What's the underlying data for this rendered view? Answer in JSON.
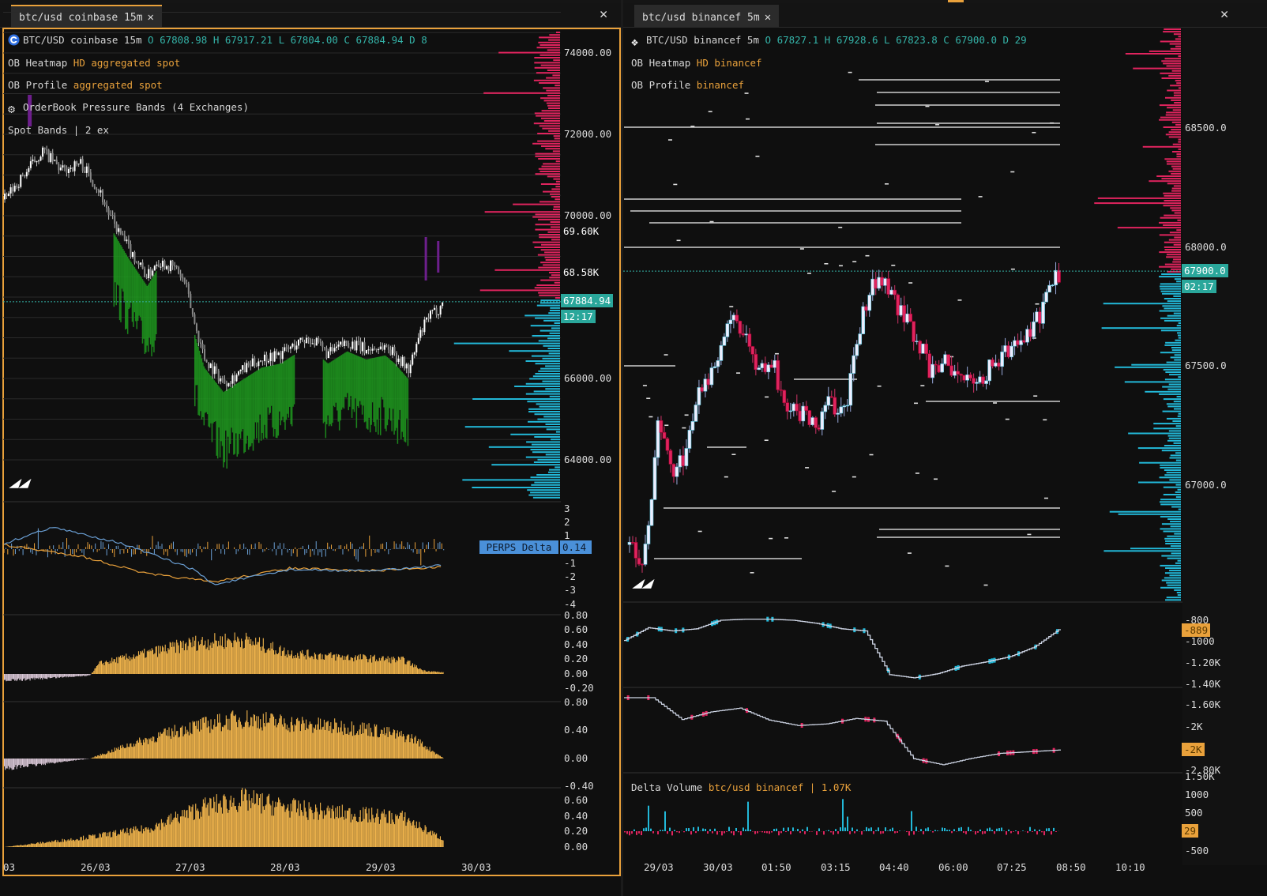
{
  "colors": {
    "accent": "#e9a13b",
    "teal": "#34b3a8",
    "bid": "#22b8d8",
    "ask": "#e0245e",
    "candle_up": "#ffffff",
    "pressure_green": "#1f9b1f",
    "delta_blue": "#4a90d9",
    "hist_yellow": "#f0b44c"
  },
  "left": {
    "tab_label": "btc/usd coinbase 15m",
    "tab_close": "✕",
    "window_close": "✕",
    "legend": {
      "symbol_icon": "coinbase-logo-icon",
      "title": "BTC/USD coinbase 15m",
      "ohlc": "O 67808.98 H 67917.21 L 67804.00 C 67884.94 D 8",
      "heatmap_label": "OB Heatmap",
      "heatmap_value": "HD aggregated spot",
      "profile_label": "OB Profile",
      "profile_value": "aggregated spot",
      "bands_icon": "gear-icon",
      "bands_label": "OrderBook Pressure Bands (4 Exchanges)",
      "spot_bands": "Spot Bands | 2 ex"
    },
    "price_axis": [
      "74000.00",
      "72000.00",
      "70000.00",
      "66000.00",
      "64000.00"
    ],
    "price_tags": {
      "high": "69.60K",
      "mid": "68.58K",
      "last": "67884.94",
      "countdown": "12:17"
    },
    "perps": {
      "label": "PERPS Delta",
      "value": "0.14",
      "ticks": [
        "3",
        "2",
        "1",
        "-1",
        "-2",
        "-3",
        "-4"
      ]
    },
    "pane2_ticks": [
      "0.80",
      "0.60",
      "0.40",
      "0.20",
      "0.00",
      "-0.20"
    ],
    "pane3_ticks": [
      "0.80",
      "0.40",
      "0.00",
      "-0.40"
    ],
    "pane4_ticks": [
      "0.60",
      "0.40",
      "0.20",
      "0.00"
    ],
    "time_axis": [
      "03",
      "26/03",
      "27/03",
      "28/03",
      "29/03",
      "30/03"
    ]
  },
  "right": {
    "tab_label": "btc/usd binancef 5m",
    "tab_close": "✕",
    "window_close": "✕",
    "legend": {
      "symbol_icon": "binance-logo-icon",
      "title": "BTC/USD binancef 5m",
      "ohlc": "O 67827.1 H 67928.6 L 67823.8 C 67900.0 D 29",
      "heatmap_label": "OB Heatmap",
      "heatmap_value": "HD binancef",
      "profile_label": "OB Profile",
      "profile_value": "binancef"
    },
    "price_axis": [
      "68500.0",
      "68000.0",
      "67500.0",
      "67000.0"
    ],
    "price_tags": {
      "last": "67900.0",
      "countdown": "02:17"
    },
    "pane1_ticks": [
      "-800",
      "-1000",
      "-1.20K",
      "-1.40K"
    ],
    "pane1_tag": "-889",
    "pane2_ticks": [
      "-1.60K",
      "-2K",
      "-2.80K"
    ],
    "pane2_tag": "-2K",
    "pane3_ticks": [
      "1.50K",
      "1000",
      "500",
      "-500"
    ],
    "pane3_tag": "29",
    "delta_volume": {
      "label": "Delta Volume",
      "value": "btc/usd binancef | 1.07K"
    },
    "time_axis": [
      "29/03",
      "30/03",
      "01:50",
      "03:15",
      "04:40",
      "06:00",
      "07:25",
      "08:50",
      "10:10"
    ]
  },
  "chart_data": [
    {
      "type": "candlestick",
      "name": "BTC/USD coinbase 15m",
      "x_unit": "day of March",
      "ylim": [
        63000,
        75000
      ],
      "close": [
        [
          25.0,
          70400
        ],
        [
          25.2,
          71000
        ],
        [
          25.4,
          71600
        ],
        [
          25.6,
          71100
        ],
        [
          25.8,
          71300
        ],
        [
          26.0,
          70600
        ],
        [
          26.1,
          70000
        ],
        [
          26.3,
          69200
        ],
        [
          26.5,
          68500
        ],
        [
          26.6,
          68900
        ],
        [
          26.8,
          68700
        ],
        [
          26.9,
          68300
        ],
        [
          27.0,
          67300
        ],
        [
          27.1,
          66500
        ],
        [
          27.3,
          65900
        ],
        [
          27.5,
          66200
        ],
        [
          27.7,
          66500
        ],
        [
          27.9,
          66600
        ],
        [
          28.1,
          66900
        ],
        [
          28.2,
          67000
        ],
        [
          28.4,
          66600
        ],
        [
          28.6,
          66900
        ],
        [
          28.8,
          66700
        ],
        [
          29.0,
          66800
        ],
        [
          29.1,
          66600
        ],
        [
          29.25,
          66200
        ],
        [
          29.35,
          67000
        ],
        [
          29.45,
          67500
        ],
        [
          29.55,
          67700
        ],
        [
          29.62,
          67885
        ]
      ]
    },
    {
      "type": "line",
      "name": "PERPS Delta",
      "x_unit": "day of March",
      "ylim": [
        -4,
        3
      ],
      "last": 0.14,
      "series": [
        {
          "name": "orange",
          "points": [
            [
              25.0,
              0.3
            ],
            [
              25.8,
              -0.5
            ],
            [
              26.5,
              -1.8
            ],
            [
              27.2,
              -2.4
            ],
            [
              28.0,
              -1.4
            ],
            [
              28.8,
              -1.6
            ],
            [
              29.6,
              -1.3
            ]
          ]
        },
        {
          "name": "blue",
          "points": [
            [
              25.0,
              0.4
            ],
            [
              25.5,
              1.6
            ],
            [
              26.2,
              0.5
            ],
            [
              27.0,
              -1.5
            ],
            [
              27.2,
              -2.6
            ],
            [
              28.0,
              -1.5
            ],
            [
              28.8,
              -1.6
            ],
            [
              29.6,
              -1.2
            ]
          ]
        }
      ]
    },
    {
      "type": "bar",
      "name": "pane 2",
      "x_unit": "day of March",
      "ylim": [
        -0.2,
        0.8
      ],
      "envelope": [
        [
          25.0,
          -0.1
        ],
        [
          25.9,
          -0.02
        ],
        [
          26.0,
          0.15
        ],
        [
          26.5,
          0.3
        ],
        [
          27.0,
          0.45
        ],
        [
          27.5,
          0.5
        ],
        [
          28.0,
          0.3
        ],
        [
          28.5,
          0.25
        ],
        [
          29.2,
          0.2
        ],
        [
          29.4,
          0.05
        ],
        [
          29.62,
          0.02
        ]
      ]
    },
    {
      "type": "bar",
      "name": "pane 3",
      "x_unit": "day of March",
      "ylim": [
        -0.4,
        0.8
      ],
      "envelope": [
        [
          25.0,
          -0.15
        ],
        [
          25.9,
          0.0
        ],
        [
          26.3,
          0.2
        ],
        [
          26.9,
          0.45
        ],
        [
          27.5,
          0.6
        ],
        [
          28.2,
          0.5
        ],
        [
          28.8,
          0.45
        ],
        [
          29.3,
          0.3
        ],
        [
          29.62,
          0.0
        ]
      ]
    },
    {
      "type": "bar",
      "name": "pane 4",
      "x_unit": "day of March",
      "ylim": [
        0,
        0.6
      ],
      "envelope": [
        [
          25.0,
          0.0
        ],
        [
          25.8,
          0.12
        ],
        [
          26.5,
          0.25
        ],
        [
          27.1,
          0.55
        ],
        [
          27.5,
          0.65
        ],
        [
          28.2,
          0.5
        ],
        [
          28.7,
          0.45
        ],
        [
          29.2,
          0.4
        ],
        [
          29.62,
          0.1
        ]
      ]
    },
    {
      "type": "candlestick",
      "name": "BTC/USD binancef 5m",
      "x_unit": "bar index",
      "ylim": [
        66550,
        68900
      ],
      "close": [
        66750,
        66650,
        67250,
        67050,
        67150,
        67420,
        67500,
        67710,
        67650,
        67480,
        67510,
        67310,
        67310,
        67250,
        67350,
        67310,
        67640,
        67880,
        67830,
        67720,
        67620,
        67480,
        67510,
        67420,
        67420,
        67480,
        67550,
        67610,
        67640,
        67780,
        67900
      ]
    },
    {
      "type": "line",
      "name": "CVD 1",
      "x_unit": "bar index",
      "ylim": [
        -1400,
        -800
      ],
      "last": -889,
      "values": [
        -990,
        -870,
        -900,
        -880,
        -800,
        -790,
        -790,
        -800,
        -830,
        -880,
        -900,
        -1310,
        -1340,
        -1300,
        -1230,
        -1190,
        -1140,
        -1050,
        -889
      ]
    },
    {
      "type": "line",
      "name": "CVD 2",
      "x_unit": "bar index",
      "ylim": [
        -2800,
        -1600
      ],
      "last": -2000,
      "values": [
        -1470,
        -1470,
        -1870,
        -1730,
        -1660,
        -1880,
        -1980,
        -1950,
        -1850,
        -1900,
        -2590,
        -2700,
        -2580,
        -2490,
        -2460,
        -2430
      ]
    },
    {
      "type": "bar",
      "name": "Delta Volume",
      "x_unit": "bar index",
      "ylim": [
        -500,
        1500
      ],
      "last": 29,
      "value": "1.07K"
    }
  ]
}
